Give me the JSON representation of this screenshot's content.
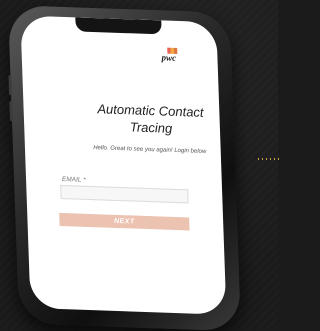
{
  "brand": {
    "logo_text": "pwc"
  },
  "app": {
    "title": "Automatic Contact Tracing",
    "subtitle": "Hello. Great to see you again! Login below"
  },
  "form": {
    "email_label": "EMAIL *",
    "email_value": "",
    "next_label": "NEXT"
  },
  "colors": {
    "background": "#1b1b1b",
    "button": "#ecc3b1",
    "accent_dots": "#c9a24a"
  }
}
